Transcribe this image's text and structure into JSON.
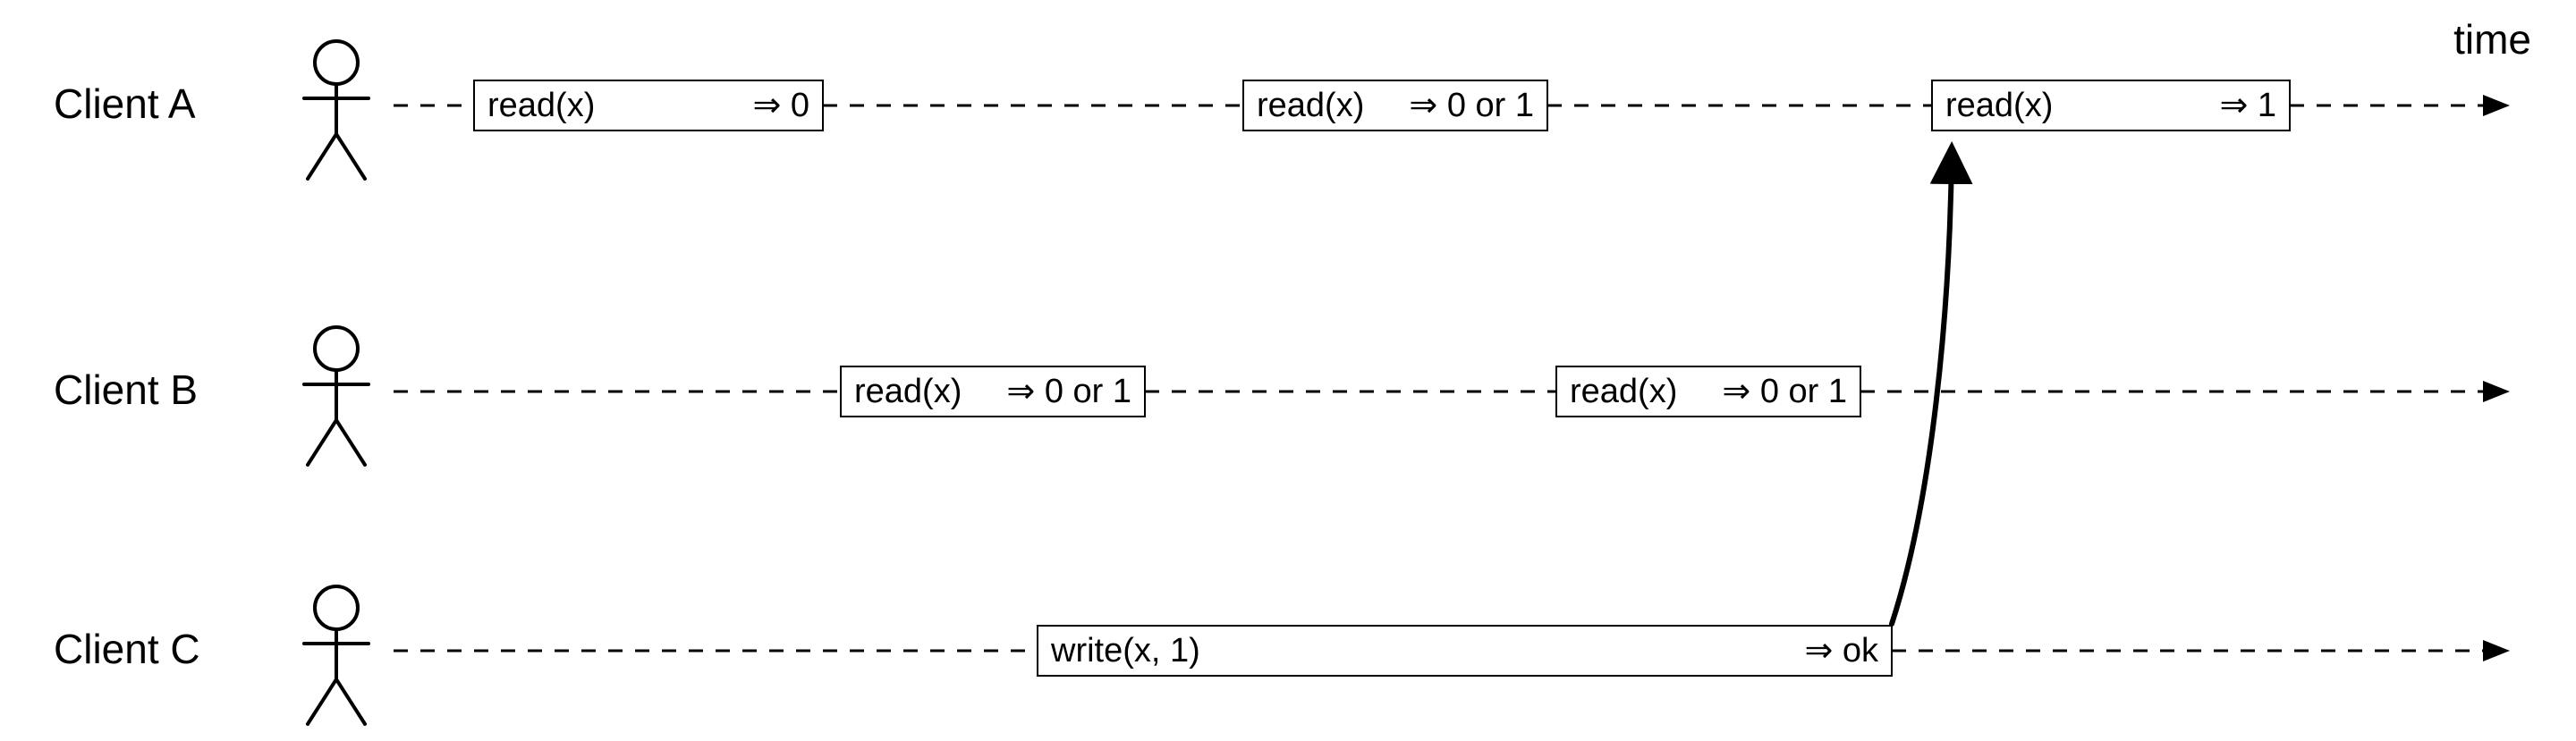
{
  "axis": {
    "label": "time"
  },
  "clients": {
    "a": {
      "label": "Client A"
    },
    "b": {
      "label": "Client B"
    },
    "c": {
      "label": "Client C"
    }
  },
  "ops": {
    "a1": {
      "call": "read(x)",
      "result": "⇒ 0"
    },
    "a2": {
      "call": "read(x)",
      "result": "⇒ 0 or 1"
    },
    "a3": {
      "call": "read(x)",
      "result": "⇒ 1"
    },
    "b1": {
      "call": "read(x)",
      "result": "⇒ 0 or 1"
    },
    "b2": {
      "call": "read(x)",
      "result": "⇒ 0 or 1"
    },
    "c1": {
      "call": "write(x, 1)",
      "result": "⇒ ok"
    }
  }
}
